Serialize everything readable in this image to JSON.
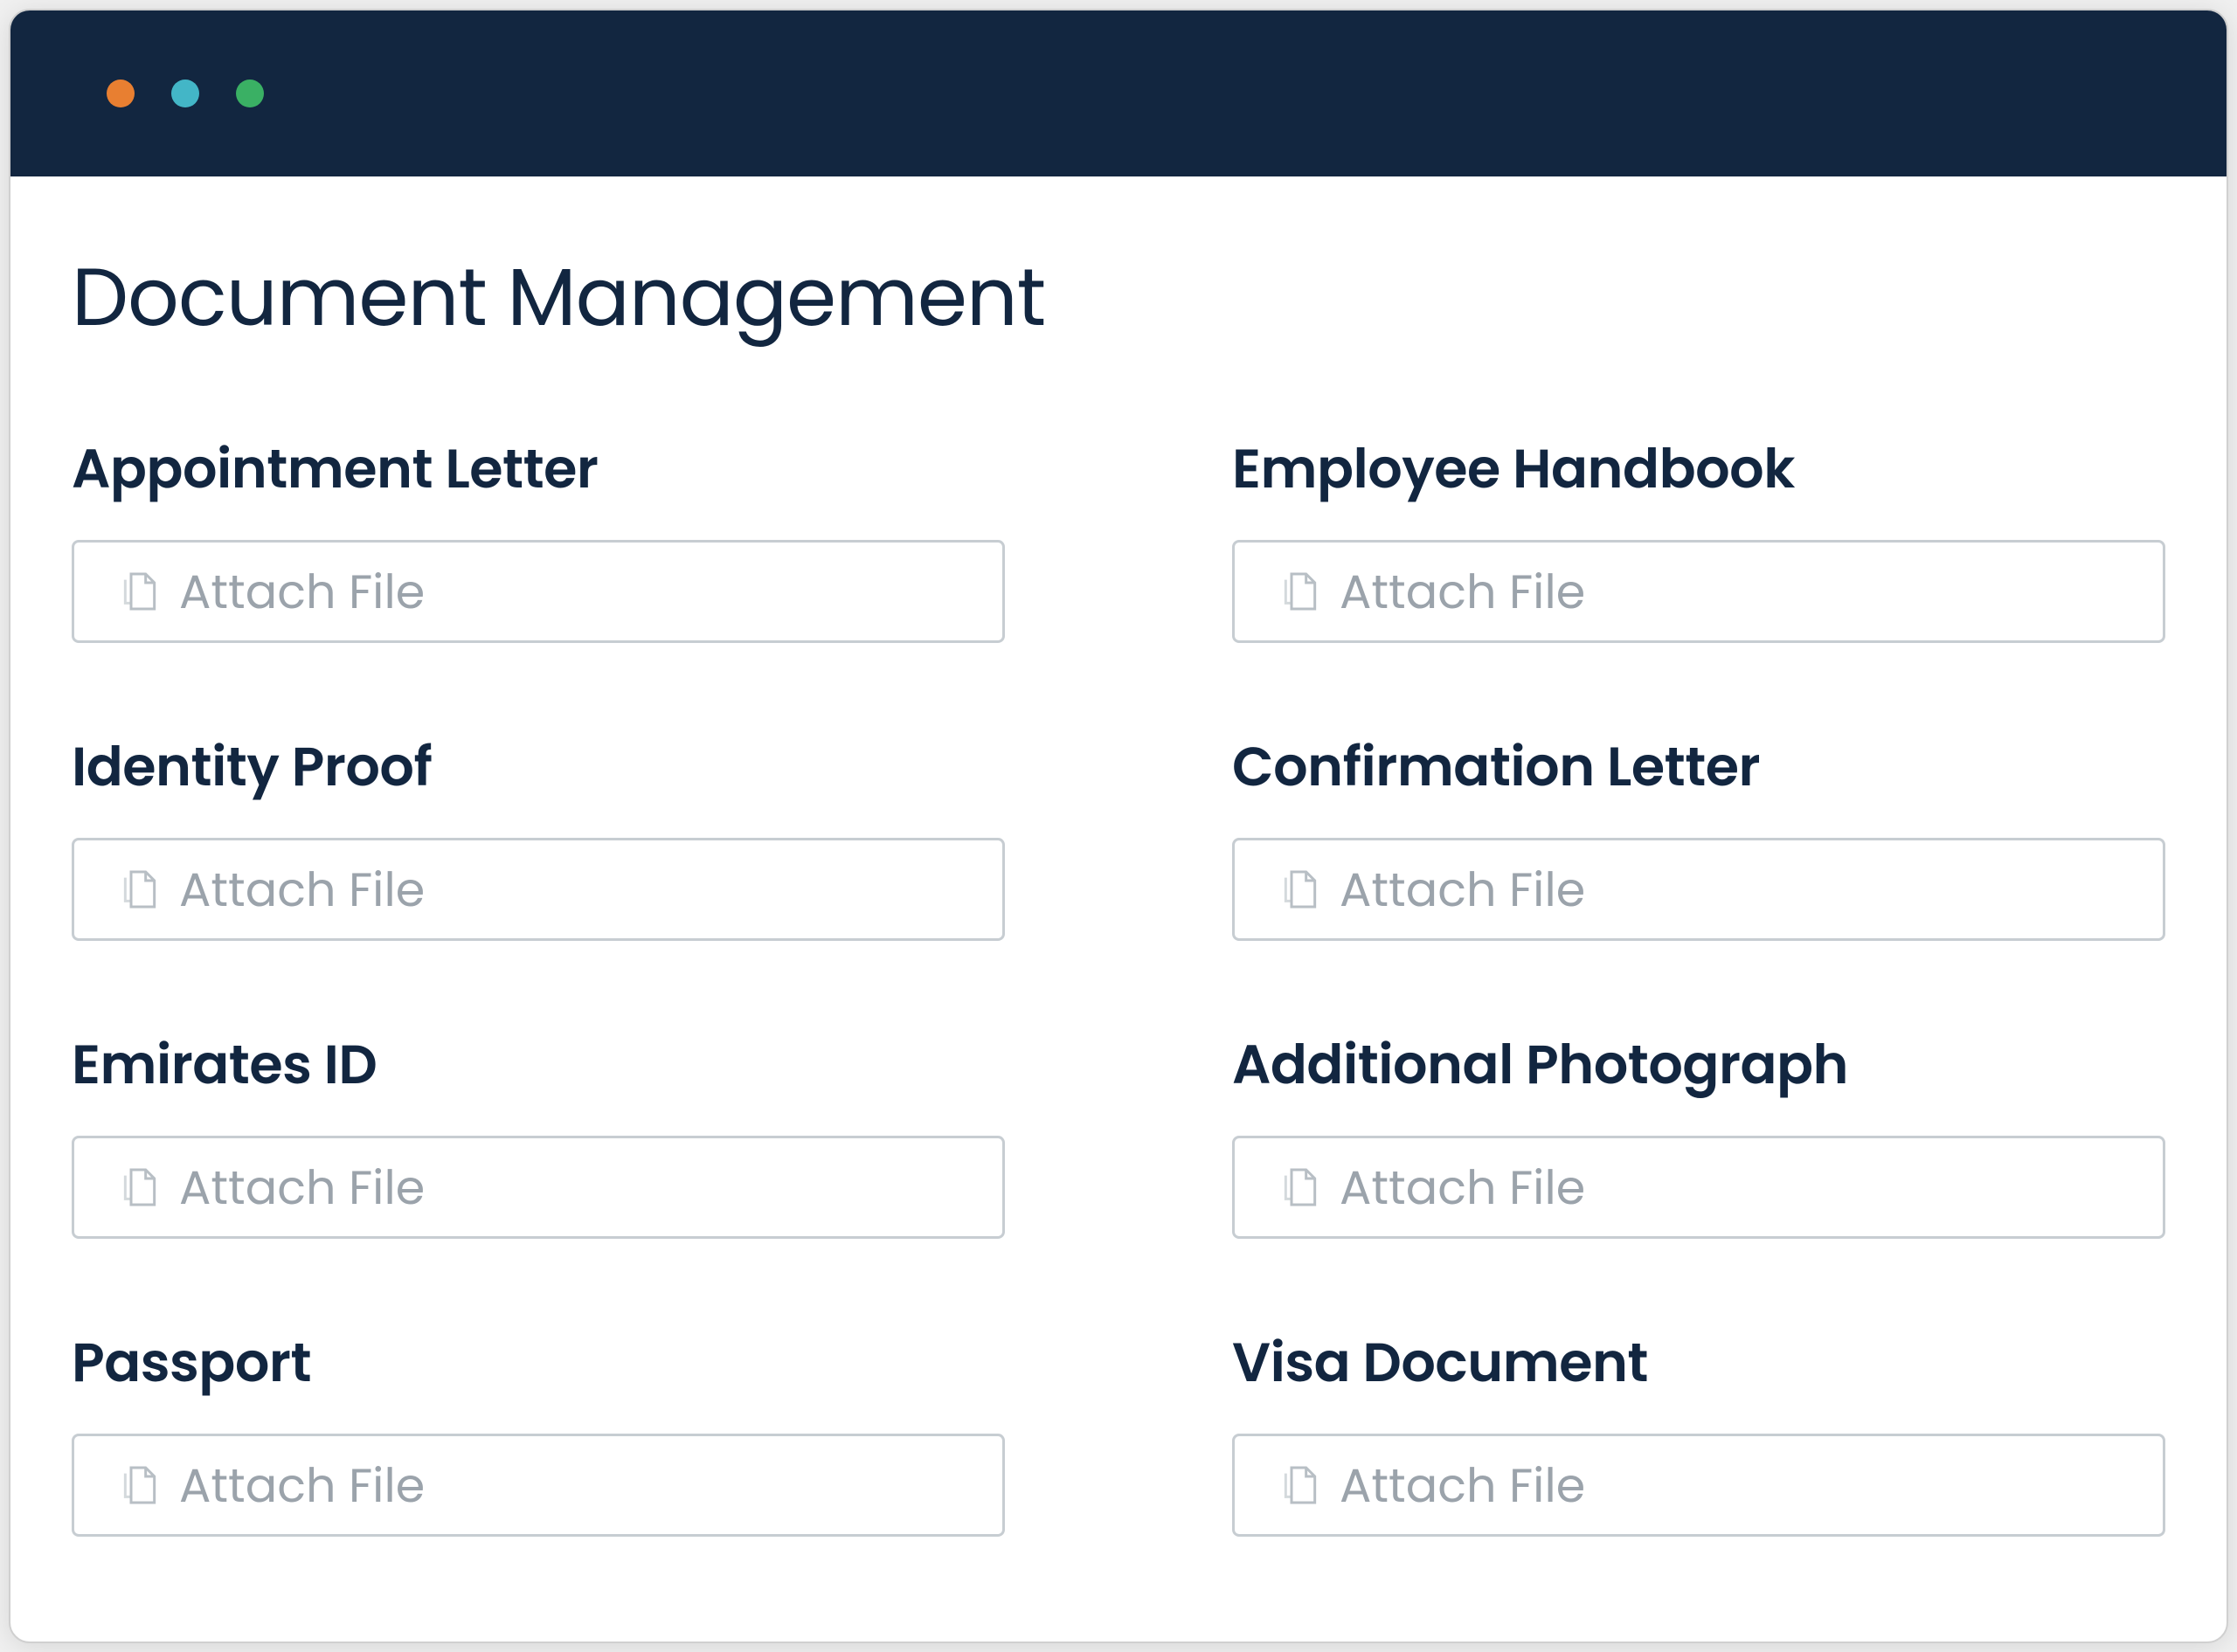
{
  "page": {
    "title": "Document Management"
  },
  "fields": {
    "attach_label": "Attach File",
    "left": [
      {
        "label": "Appointment Letter"
      },
      {
        "label": "Identity Proof"
      },
      {
        "label": "Emirates ID"
      },
      {
        "label": "Passport"
      }
    ],
    "right": [
      {
        "label": "Employee Handbook"
      },
      {
        "label": "Confirmation Letter"
      },
      {
        "label": "Additional Photograph"
      },
      {
        "label": "Visa Document"
      }
    ]
  },
  "colors": {
    "titlebar": "#122640",
    "border": "#c7cdd2",
    "placeholder": "#9ba3ab"
  }
}
